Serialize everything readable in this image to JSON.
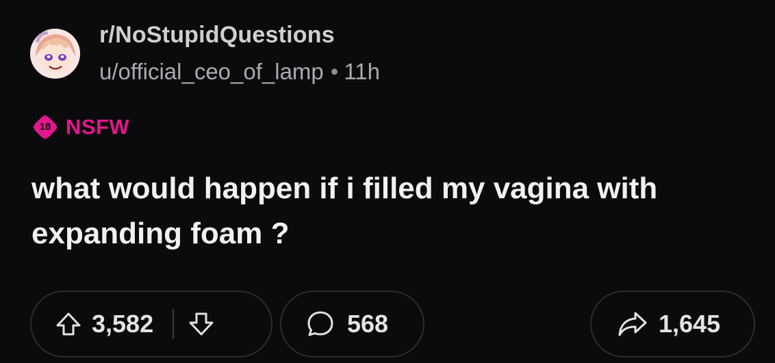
{
  "post": {
    "subreddit": "r/NoStupidQuestions",
    "author": "u/official_ceo_of_lamp",
    "separator": "•",
    "age": "11h",
    "nsfw_badge": "18",
    "nsfw_label": "NSFW",
    "title": "what would happen if i filled my vagina with expanding foam ?"
  },
  "actions": {
    "upvotes": "3,582",
    "comments": "568",
    "shares": "1,645"
  },
  "colors": {
    "background": "#0b0b0d",
    "nsfw_accent": "#e0188b",
    "pill_border": "#2c2d30"
  },
  "icons": {
    "avatar": "avatar-image",
    "upvote": "arrow-up-icon",
    "downvote": "arrow-down-icon",
    "comment": "comment-bubble-icon",
    "share": "share-arrow-icon"
  }
}
